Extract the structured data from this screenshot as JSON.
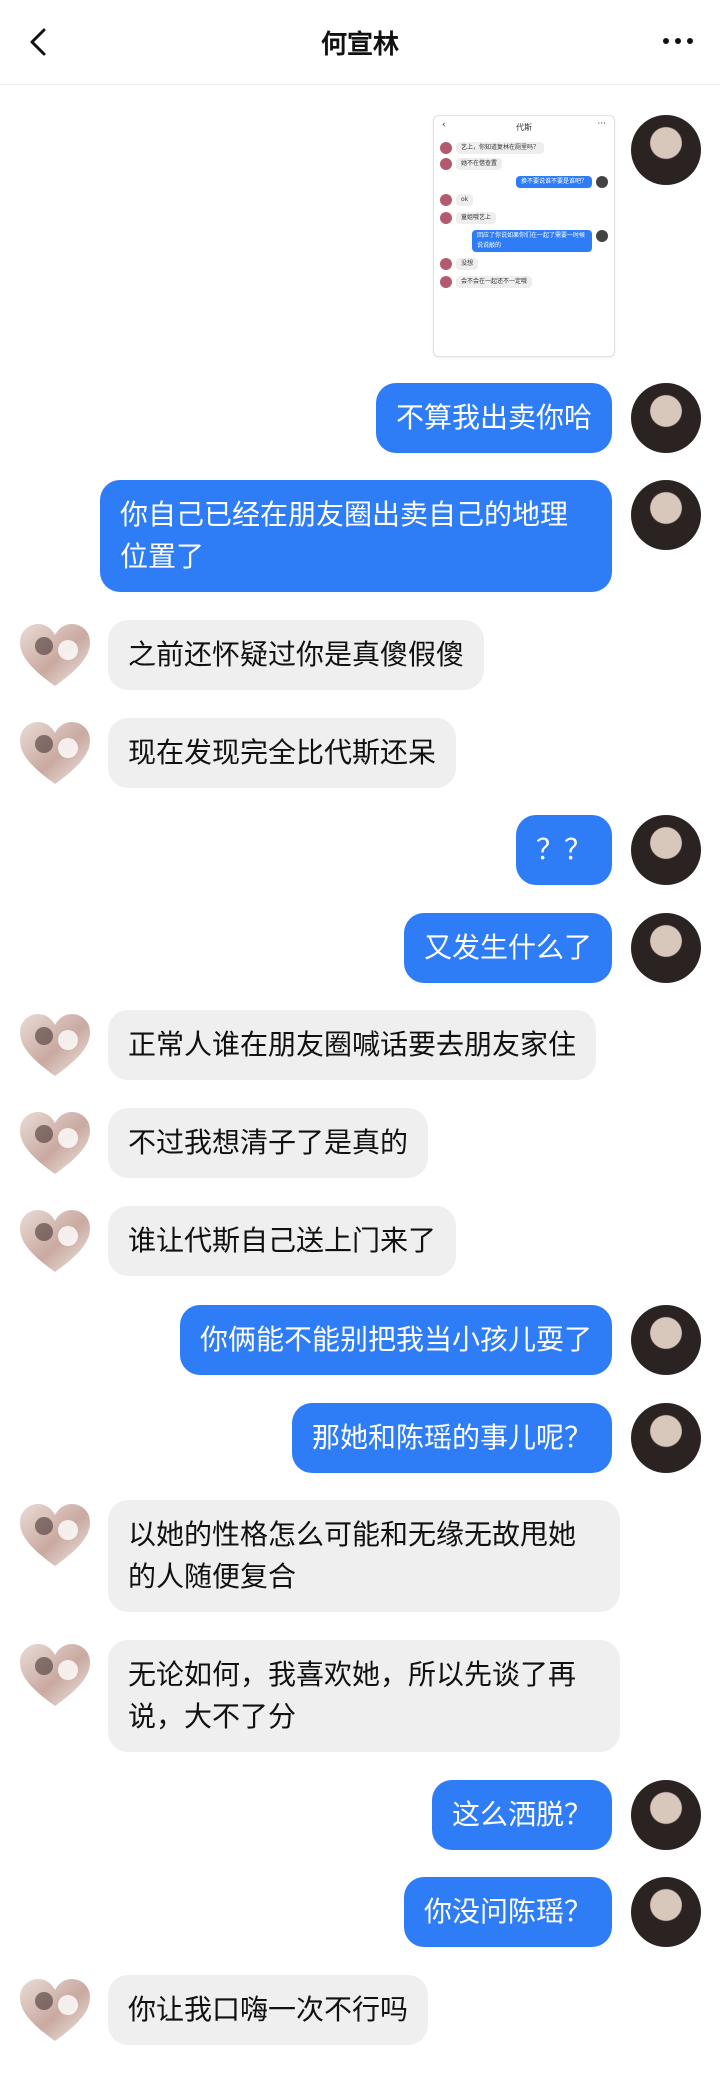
{
  "header": {
    "title": "何宣林"
  },
  "attachment": {
    "title": "代斯",
    "messages": [
      {
        "side": "in",
        "text": "艺上，你知道复林在厕里吗？"
      },
      {
        "side": "in",
        "text": "她不在借查置"
      },
      {
        "side": "out",
        "text": "换不要说谁不要是谁吧？"
      },
      {
        "side": "in",
        "text": "ok"
      },
      {
        "side": "in",
        "text": "童姐哦艺上"
      },
      {
        "side": "out",
        "text": "回应了你说如果你们在一起了需要一时候说说敲的"
      },
      {
        "side": "in",
        "text": "没想"
      },
      {
        "side": "in",
        "text": "会不会在一起还不一定哦"
      }
    ]
  },
  "messages": [
    {
      "side": "out",
      "text": "不算我出卖你哈"
    },
    {
      "side": "out",
      "text": "你自己已经在朋友圈出卖自己的地理位置了"
    },
    {
      "side": "in",
      "text": "之前还怀疑过你是真傻假傻"
    },
    {
      "side": "in",
      "text": "现在发现完全比代斯还呆"
    },
    {
      "side": "out",
      "text": "？？"
    },
    {
      "side": "out",
      "text": "又发生什么了"
    },
    {
      "side": "in",
      "text": "正常人谁在朋友圈喊话要去朋友家住"
    },
    {
      "side": "in",
      "text": "不过我想清子了是真的"
    },
    {
      "side": "in",
      "text": "谁让代斯自己送上门来了"
    },
    {
      "side": "out",
      "text": "你俩能不能别把我当小孩儿耍了"
    },
    {
      "side": "out",
      "text": "那她和陈瑶的事儿呢？"
    },
    {
      "side": "in",
      "text": "以她的性格怎么可能和无缘无故甩她的人随便复合"
    },
    {
      "side": "in",
      "text": "无论如何，我喜欢她，所以先谈了再说，大不了分"
    },
    {
      "side": "out",
      "text": "这么洒脱？"
    },
    {
      "side": "out",
      "text": "你没问陈瑶？"
    },
    {
      "side": "in",
      "text": "你让我口嗨一次不行吗"
    }
  ],
  "colors": {
    "outgoing": "#2e7cf6",
    "incoming": "#efefef"
  }
}
